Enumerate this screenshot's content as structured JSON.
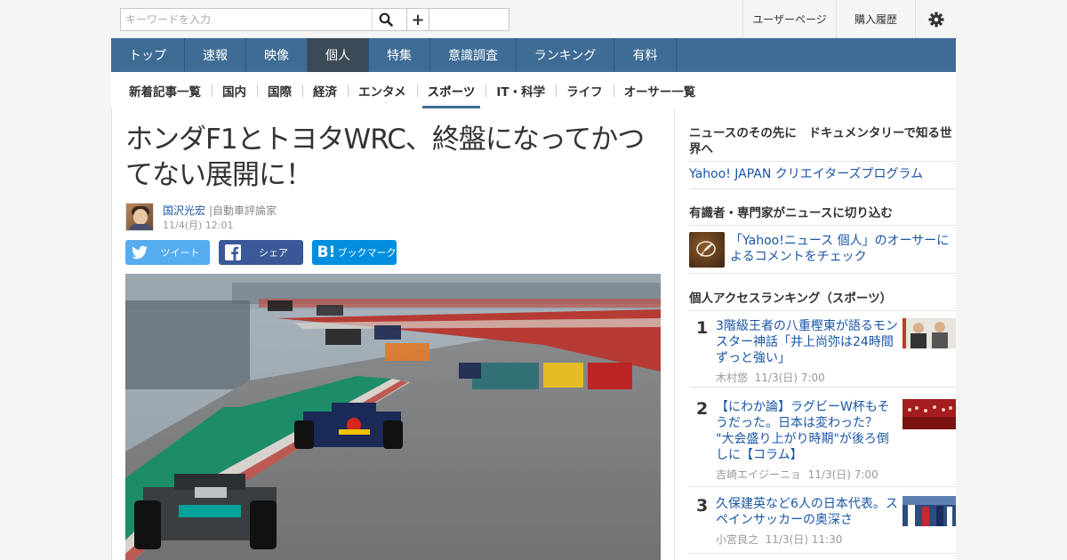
{
  "search": {
    "placeholder": "キーワードを入力"
  },
  "utility": {
    "user_page": "ユーザーページ",
    "purchase_history": "購入履歴"
  },
  "main_nav": [
    {
      "label": "トップ"
    },
    {
      "label": "速報"
    },
    {
      "label": "映像"
    },
    {
      "label": "個人",
      "active": true
    },
    {
      "label": "特集"
    },
    {
      "label": "意識調査"
    },
    {
      "label": "ランキング"
    },
    {
      "label": "有料"
    }
  ],
  "sub_nav": [
    {
      "label": "新着記事一覧"
    },
    {
      "label": "国内"
    },
    {
      "label": "国際"
    },
    {
      "label": "経済"
    },
    {
      "label": "エンタメ"
    },
    {
      "label": "スポーツ",
      "active": true
    },
    {
      "label": "IT・科学"
    },
    {
      "label": "ライフ"
    },
    {
      "label": "オーサー一覧"
    }
  ],
  "article": {
    "title": "ホンダF1とトヨタWRC、終盤になってかつてない展開に！",
    "author_name": "国沢光宏",
    "author_role": "|自動車評論家",
    "date": "11/4(月) 12:01",
    "share": {
      "twitter": "ツイート",
      "facebook": "シェア",
      "hatena": "ブックマーク"
    }
  },
  "sidebar": {
    "promo_heading": "ニュースのその先に　ドキュメンタリーで知る世界へ",
    "promo_link": "Yahoo! JAPAN クリエイターズプログラム",
    "expert_heading": "有識者・専門家がニュースに切り込む",
    "expert_link": "「Yahoo!ニュース 個人」のオーサーによるコメントをチェック",
    "ranking_heading": "個人アクセスランキング（スポーツ）",
    "ranking": [
      {
        "rank": "1",
        "title": "3階級王者の八重樫東が語るモンスター神話「井上尚弥は24時間ずっと強い」",
        "author": "木村悠",
        "date": "11/3(日) 7:00"
      },
      {
        "rank": "2",
        "title": "【にわか論】ラグビーW杯もそうだった。日本は変わった？ \"大会盛り上がり時期\"が後ろ倒しに【コラム】",
        "author": "吉崎エイジーニョ",
        "date": "11/3(日) 7:00"
      },
      {
        "rank": "3",
        "title": "久保建英など6人の日本代表。スペインサッカーの奥深さ",
        "author": "小宮良之",
        "date": "11/3(日) 11:30"
      }
    ]
  },
  "colors": {
    "nav": "#3e6c95",
    "nav_active": "#3b4a57",
    "link": "#1a55a5"
  }
}
